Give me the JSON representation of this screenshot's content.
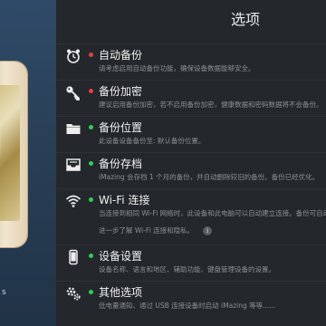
{
  "header": {
    "title": "选项"
  },
  "left": {
    "footer_text": "s"
  },
  "rows": [
    {
      "label": "自动备份",
      "desc": "请考虑启用自动备份功能，确保设备数据能够安全。",
      "status": "off",
      "icon": "alarm-clock-icon"
    },
    {
      "label": "备份加密",
      "desc": "建议启用备份加密，若不启用备份加密，健康数据和密码数据将不会备份。",
      "status": "off",
      "icon": "key-icon"
    },
    {
      "label": "备份位置",
      "desc": "此设备设备备份至: 默认备份位置。",
      "status": "on",
      "icon": "folder-icon"
    },
    {
      "label": "备份存档",
      "desc": "iMazing 会存档 1 个月的备份，并自动删除较旧的备份。备份已经优化。",
      "status": "on",
      "icon": "archive-tray-icon"
    },
    {
      "label": "Wi-Fi 连接",
      "desc": "当连接到相同 Wi-Fi 网络时，此设备和此电脑可以自动建立连接。备份可自动",
      "desc2": "进一步了解 Wi-Fi 连接和隐私。",
      "status": "on",
      "icon": "wifi-icon"
    },
    {
      "label": "设备设置",
      "desc": "设备名称、语言和地区、辅助功能、键盘管理设备的设置。",
      "status": "on",
      "icon": "phone-icon"
    },
    {
      "label": "其他选项",
      "desc": "低电量通知、通过 USB 连接设备时启动 iMazing 等等......",
      "status": "on",
      "icon": "gears-icon"
    }
  ],
  "colors": {
    "status_off": "#e24343",
    "status_on": "#2fcf56"
  }
}
